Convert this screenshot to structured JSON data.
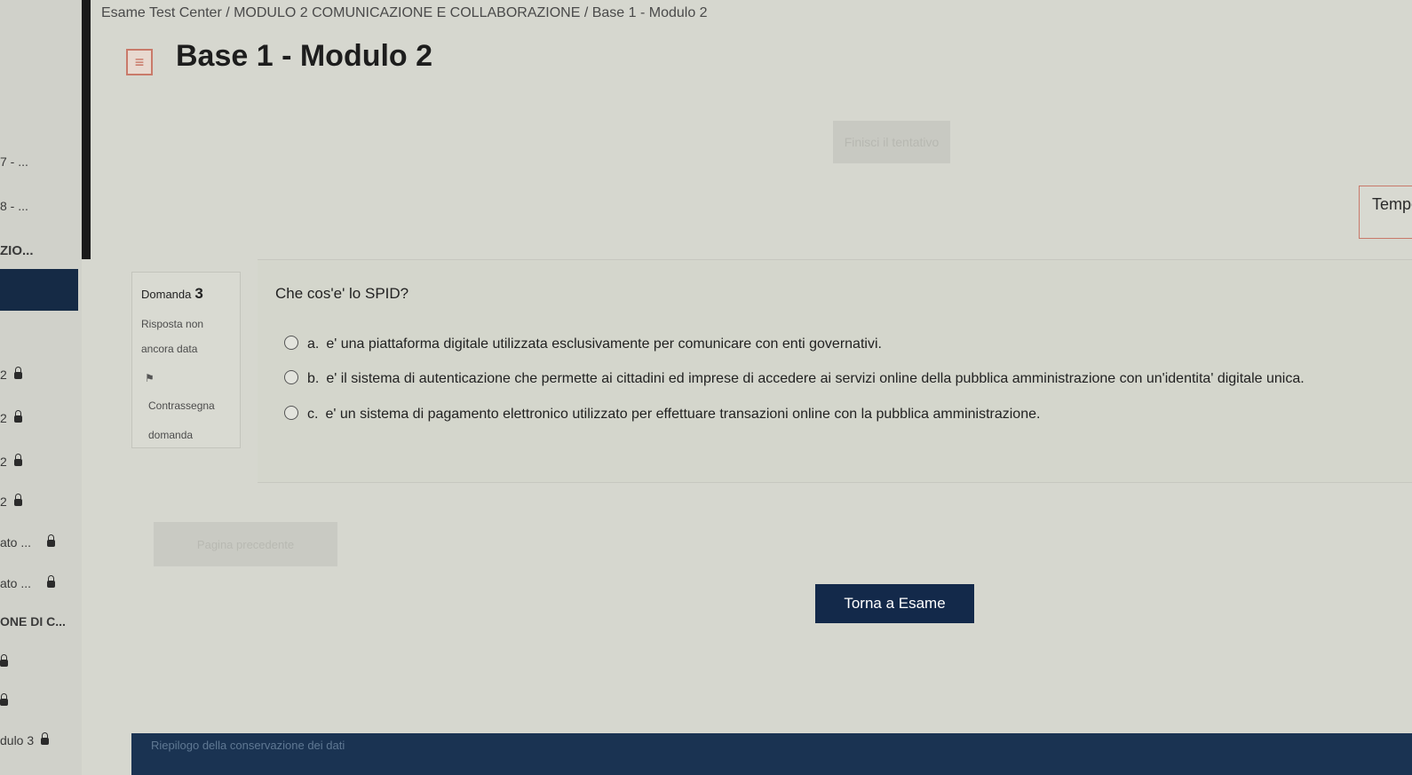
{
  "breadcrumb": "Esame Test Center  /  MODULO 2 COMUNICAZIONE E COLLABORAZIONE  /  Base 1 - Modulo 2",
  "page": {
    "title": "Base 1 - Modulo 2",
    "title_icon": "quiz-icon",
    "finish_label": "Finisci il tentativo",
    "timer_label": "Tempo"
  },
  "sidebar": {
    "items": [
      {
        "label": "7 - ..."
      },
      {
        "label": "8 - ..."
      },
      {
        "label": "ZIO..."
      },
      {
        "label": "2"
      },
      {
        "label": "2"
      },
      {
        "label": "2"
      },
      {
        "label": "2"
      },
      {
        "label": "ato ..."
      },
      {
        "label": "ato ..."
      },
      {
        "label": "ONE DI C..."
      },
      {
        "label": ""
      },
      {
        "label": ""
      },
      {
        "label": "dulo 3"
      }
    ]
  },
  "question": {
    "number_label": "Domanda",
    "number": "3",
    "status": "Risposta non ancora data",
    "flag_label": "Contrassegna domanda",
    "text": "Che cos'e' lo SPID?",
    "answers": [
      {
        "letter": "a.",
        "text": "e' una piattaforma digitale utilizzata esclusivamente per comunicare con enti governativi."
      },
      {
        "letter": "b.",
        "text": "e' il sistema di autenticazione che permette ai cittadini ed imprese di accedere ai servizi online della pubblica amministrazione con un'identita' digitale unica."
      },
      {
        "letter": "c.",
        "text": "e' un sistema di pagamento elettronico utilizzato per effettuare transazioni online con la pubblica amministrazione."
      }
    ]
  },
  "nav": {
    "prev_label": "Pagina precedente",
    "back_label": "Torna a Esame"
  },
  "footer": {
    "link": "Riepilogo della conservazione dei dati"
  },
  "colors": {
    "primary": "#13294a",
    "background": "#d6d7cf"
  }
}
